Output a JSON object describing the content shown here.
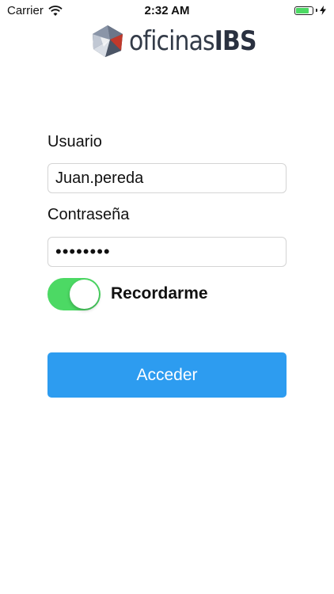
{
  "status_bar": {
    "carrier": "Carrier",
    "time": "2:32 AM",
    "battery_level": 0.8,
    "battery_color": "#4cd964"
  },
  "logo": {
    "text_regular": "oficinas",
    "text_bold": "IBS"
  },
  "form": {
    "user_label": "Usuario",
    "user_value": "Juan.pereda",
    "password_label": "Contraseña",
    "password_value": "••••••••",
    "remember_label": "Recordarme",
    "remember_on": true,
    "toggle_color": "#4cd964",
    "submit_label": "Acceder",
    "submit_color": "#2d9cf0"
  },
  "icons": [
    "wifi-icon",
    "battery-icon",
    "charging-bolt-icon",
    "logo-mark-icon"
  ]
}
